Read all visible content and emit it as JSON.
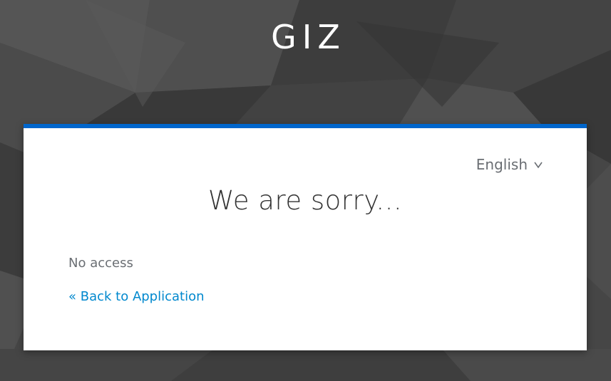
{
  "header": {
    "brand": "GIZ"
  },
  "language": {
    "selected": "English",
    "icon": "chevron-down-icon"
  },
  "error": {
    "title": "We are sorry...",
    "message": "No access",
    "back_link": "« Back to Application"
  },
  "colors": {
    "accent": "#0066cc",
    "link": "#0088ce",
    "background": "#4a4a4a",
    "card": "#ffffff",
    "text_muted": "#6a6e73",
    "title": "#333333"
  }
}
